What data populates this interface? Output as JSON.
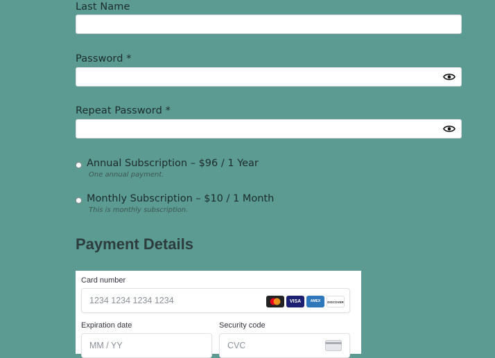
{
  "form": {
    "last_name_label": "Last Name",
    "password_label": "Password *",
    "repeat_password_label": "Repeat Password *"
  },
  "plans": [
    {
      "label": "Annual Subscription – $96 / 1 Year",
      "description": "One annual payment."
    },
    {
      "label": "Monthly Subscription – $10 / 1 Month",
      "description": "This is monthly subscription."
    }
  ],
  "payment": {
    "title": "Payment Details",
    "card_number_label": "Card number",
    "card_number_placeholder": "1234 1234 1234 1234",
    "expiry_label": "Expiration date",
    "expiry_placeholder": "MM / YY",
    "cvc_label": "Security code",
    "cvc_placeholder": "CVC",
    "brands": [
      "MC",
      "VISA",
      "AMEX",
      "DISCOVER"
    ]
  },
  "colors": {
    "background": "#5b9b91",
    "visa": "#1a1f71",
    "amex": "#2e77bb",
    "mastercard_red": "#eb001b",
    "mastercard_orange": "#f79e1b"
  },
  "icons": {
    "password_toggle": "eye-icon",
    "cvc_hint": "credit-card-icon"
  }
}
